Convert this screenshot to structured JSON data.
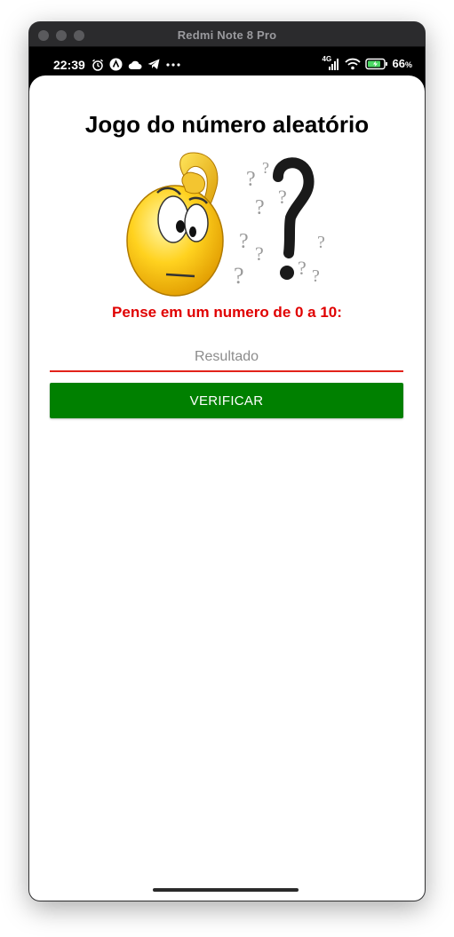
{
  "window": {
    "title": "Redmi Note 8 Pro"
  },
  "status_bar": {
    "time": "22:39",
    "network": "4G",
    "battery": "66"
  },
  "app": {
    "title": "Jogo do número aleatório",
    "prompt": "Pense em um numero de 0 a 10:",
    "result_placeholder": "Resultado",
    "result_value": "",
    "verify_label": "VERIFICAR"
  },
  "colors": {
    "prompt": "#e00000",
    "underline": "#e2231a",
    "button": "#008000"
  }
}
